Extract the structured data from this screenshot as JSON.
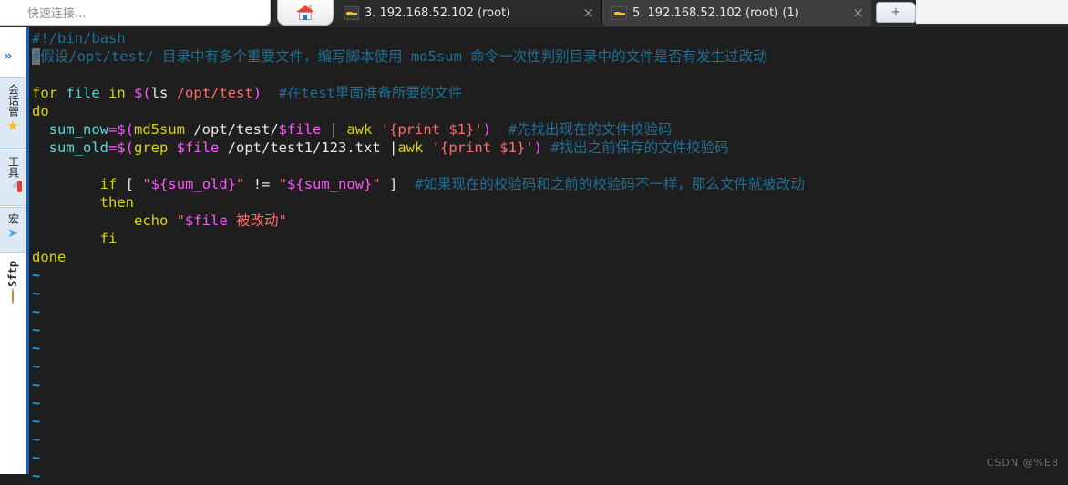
{
  "window": {
    "quick_connect": {
      "placeholder": "快速连接...",
      "value": ""
    },
    "home_tab_label": "home",
    "new_tab_label": "+",
    "tabs": [
      {
        "label": "3. 192.168.52.102 (root)",
        "icon": "key-icon",
        "close": "×",
        "active": false
      },
      {
        "label": "5. 192.168.52.102 (root) (1)",
        "icon": "key-icon",
        "close": "×",
        "active": true
      }
    ]
  },
  "sidebar": {
    "expand_icon": "»",
    "items": [
      {
        "label": "会话管",
        "icon": "star-icon",
        "selected": true
      },
      {
        "label": "工具",
        "icon": "swiss-knife-icon",
        "selected": true
      },
      {
        "label": "宏",
        "icon": "paper-plane-icon",
        "selected": true
      },
      {
        "label": "Sftp",
        "icon": "globe-icon",
        "selected": false
      }
    ]
  },
  "terminal": {
    "lines": [
      {
        "type": "code",
        "tokens": [
          {
            "t": "#!/bin/bash",
            "c": "c-cmt"
          }
        ]
      },
      {
        "type": "code",
        "tokens": [
          {
            "t": "#",
            "c": "cursor"
          },
          {
            "t": "假设/opt/test/ 目录中有多个重要文件，编写脚本使用 md5sum 命令一次性判别目录中的文件是否有发生过改动",
            "c": "c-cmt"
          }
        ]
      },
      {
        "type": "blank",
        "tokens": []
      },
      {
        "type": "code",
        "tokens": [
          {
            "t": "for",
            "c": "c-kw"
          },
          {
            "t": " ",
            "c": "c-pln"
          },
          {
            "t": "file",
            "c": "c-var"
          },
          {
            "t": " ",
            "c": "c-pln"
          },
          {
            "t": "in",
            "c": "c-kw"
          },
          {
            "t": " ",
            "c": "c-pln"
          },
          {
            "t": "$(",
            "c": "c-op"
          },
          {
            "t": "ls",
            "c": "c-pln"
          },
          {
            "t": " /opt/test",
            "c": "c-str"
          },
          {
            "t": ")",
            "c": "c-op"
          },
          {
            "t": "  ",
            "c": "c-pln"
          },
          {
            "t": "#在test里面准备所要的文件",
            "c": "c-cmt"
          }
        ]
      },
      {
        "type": "code",
        "tokens": [
          {
            "t": "do",
            "c": "c-kw"
          }
        ]
      },
      {
        "type": "code",
        "tokens": [
          {
            "t": "  ",
            "c": "c-pln"
          },
          {
            "t": "sum_now",
            "c": "c-var"
          },
          {
            "t": "=",
            "c": "c-op"
          },
          {
            "t": "$(",
            "c": "c-op"
          },
          {
            "t": "md5sum",
            "c": "c-kw"
          },
          {
            "t": " /opt/test/",
            "c": "c-pln"
          },
          {
            "t": "$file",
            "c": "c-op"
          },
          {
            "t": " | ",
            "c": "c-pln"
          },
          {
            "t": "awk",
            "c": "c-kw"
          },
          {
            "t": " ",
            "c": "c-pln"
          },
          {
            "t": "'{print $1}'",
            "c": "c-str"
          },
          {
            "t": ")",
            "c": "c-op"
          },
          {
            "t": "  ",
            "c": "c-pln"
          },
          {
            "t": "#先找出现在的文件校验码",
            "c": "c-cmt"
          }
        ]
      },
      {
        "type": "code",
        "tokens": [
          {
            "t": "  ",
            "c": "c-pln"
          },
          {
            "t": "sum_old",
            "c": "c-var"
          },
          {
            "t": "=",
            "c": "c-op"
          },
          {
            "t": "$(",
            "c": "c-op"
          },
          {
            "t": "grep",
            "c": "c-kw"
          },
          {
            "t": " ",
            "c": "c-pln"
          },
          {
            "t": "$file",
            "c": "c-op"
          },
          {
            "t": " /opt/test1/123.txt |",
            "c": "c-pln"
          },
          {
            "t": "awk",
            "c": "c-kw"
          },
          {
            "t": " ",
            "c": "c-pln"
          },
          {
            "t": "'{print $1}'",
            "c": "c-str"
          },
          {
            "t": ")",
            "c": "c-op"
          },
          {
            "t": " ",
            "c": "c-pln"
          },
          {
            "t": "#找出之前保存的文件校验码",
            "c": "c-cmt"
          }
        ]
      },
      {
        "type": "blank",
        "tokens": []
      },
      {
        "type": "code",
        "tokens": [
          {
            "t": "        ",
            "c": "c-pln"
          },
          {
            "t": "if",
            "c": "c-kw"
          },
          {
            "t": " ",
            "c": "c-pln"
          },
          {
            "t": "[",
            "c": "c-pln"
          },
          {
            "t": " ",
            "c": "c-pln"
          },
          {
            "t": "\"",
            "c": "c-str"
          },
          {
            "t": "${sum_old}",
            "c": "c-op"
          },
          {
            "t": "\"",
            "c": "c-str"
          },
          {
            "t": " != ",
            "c": "c-pln"
          },
          {
            "t": "\"",
            "c": "c-str"
          },
          {
            "t": "${sum_now}",
            "c": "c-op"
          },
          {
            "t": "\"",
            "c": "c-str"
          },
          {
            "t": " ]",
            "c": "c-pln"
          },
          {
            "t": "  ",
            "c": "c-pln"
          },
          {
            "t": "#如果现在的校验码和之前的校验码不一样，那么文件就被改动",
            "c": "c-cmt"
          }
        ]
      },
      {
        "type": "code",
        "tokens": [
          {
            "t": "        ",
            "c": "c-pln"
          },
          {
            "t": "then",
            "c": "c-kw"
          }
        ]
      },
      {
        "type": "code",
        "tokens": [
          {
            "t": "            ",
            "c": "c-pln"
          },
          {
            "t": "echo",
            "c": "c-kw"
          },
          {
            "t": " ",
            "c": "c-pln"
          },
          {
            "t": "\"",
            "c": "c-str"
          },
          {
            "t": "$file",
            "c": "c-op"
          },
          {
            "t": " 被改动\"",
            "c": "c-str"
          }
        ]
      },
      {
        "type": "code",
        "tokens": [
          {
            "t": "        ",
            "c": "c-pln"
          },
          {
            "t": "fi",
            "c": "c-kw"
          }
        ]
      },
      {
        "type": "code",
        "tokens": [
          {
            "t": "done",
            "c": "c-kw"
          }
        ]
      },
      {
        "type": "tilde",
        "tokens": [
          {
            "t": "~",
            "c": "c-tilde"
          }
        ]
      },
      {
        "type": "tilde",
        "tokens": [
          {
            "t": "~",
            "c": "c-tilde"
          }
        ]
      },
      {
        "type": "tilde",
        "tokens": [
          {
            "t": "~",
            "c": "c-tilde"
          }
        ]
      },
      {
        "type": "tilde",
        "tokens": [
          {
            "t": "~",
            "c": "c-tilde"
          }
        ]
      },
      {
        "type": "tilde",
        "tokens": [
          {
            "t": "~",
            "c": "c-tilde"
          }
        ]
      },
      {
        "type": "tilde",
        "tokens": [
          {
            "t": "~",
            "c": "c-tilde"
          }
        ]
      },
      {
        "type": "tilde",
        "tokens": [
          {
            "t": "~",
            "c": "c-tilde"
          }
        ]
      },
      {
        "type": "tilde",
        "tokens": [
          {
            "t": "~",
            "c": "c-tilde"
          }
        ]
      },
      {
        "type": "tilde",
        "tokens": [
          {
            "t": "~",
            "c": "c-tilde"
          }
        ]
      },
      {
        "type": "tilde",
        "tokens": [
          {
            "t": "~",
            "c": "c-tilde"
          }
        ]
      },
      {
        "type": "tilde",
        "tokens": [
          {
            "t": "~",
            "c": "c-tilde"
          }
        ]
      },
      {
        "type": "tilde",
        "tokens": [
          {
            "t": "~",
            "c": "c-tilde"
          }
        ]
      }
    ]
  },
  "watermark": "CSDN @%E8",
  "colors": {
    "terminal_bg": "#1e1e1e",
    "comment": "#1f6f96",
    "keyword": "#d7d700",
    "variable": "#5fd7d7",
    "operator": "#ff55ff",
    "string": "#ff6a6a",
    "tilde": "#1f9ee0",
    "accent_bar": "#1560bd"
  }
}
